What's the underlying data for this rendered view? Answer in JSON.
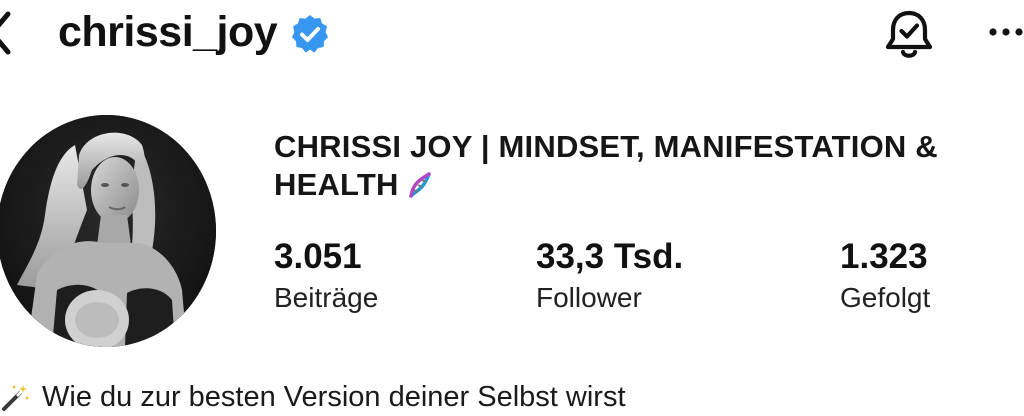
{
  "header": {
    "username": "chrissi_joy",
    "back_icon": "chevron-left-icon",
    "verified_icon": "verified-badge-icon",
    "bell_icon": "notification-bell-icon",
    "more_icon": "more-dots-icon"
  },
  "profile": {
    "display_name": "CHRISSI JOY | MINDSET, MANIFESTATION & HEALTH",
    "name_emoji_icon": "dna-icon",
    "avatar_icon": "profile-photo"
  },
  "stats": {
    "posts": {
      "value": "3.051",
      "label": "Beiträge"
    },
    "followers": {
      "value": "33,3 Tsd.",
      "label": "Follower"
    },
    "following": {
      "value": "1.323",
      "label": "Gefolgt"
    }
  },
  "bio": {
    "line1_icon": "magic-wand-icon",
    "line1": "Wie du zur besten Version deiner Selbst wirst"
  },
  "colors": {
    "text": "#111111",
    "verified_blue": "#3797F0",
    "background": "#ffffff"
  }
}
